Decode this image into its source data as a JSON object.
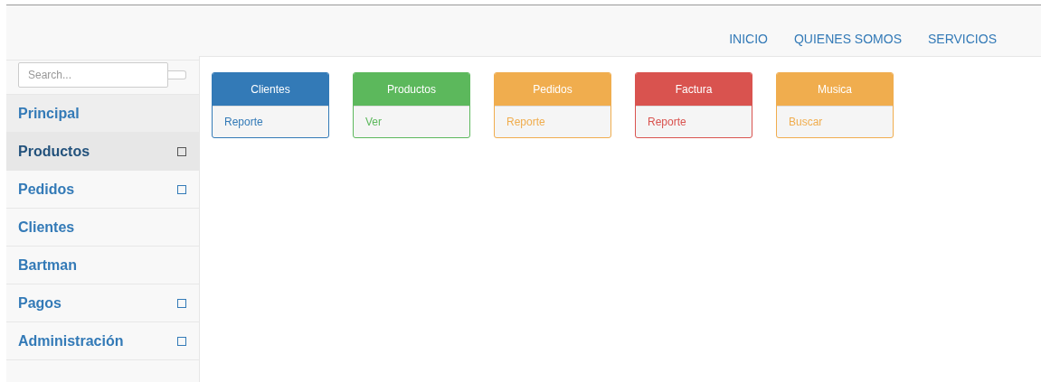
{
  "navbar": {
    "links": [
      {
        "label": "INICIO"
      },
      {
        "label": "QUIENES SOMOS"
      },
      {
        "label": "SERVICIOS"
      }
    ]
  },
  "sidebar": {
    "search": {
      "placeholder": "Search..."
    },
    "items": [
      {
        "label": "Principal",
        "kind": "heading",
        "selected": false,
        "has_submenu": false
      },
      {
        "label": "Productos",
        "kind": "item",
        "selected": true,
        "has_submenu": true
      },
      {
        "label": "Pedidos",
        "kind": "item",
        "selected": false,
        "has_submenu": true
      },
      {
        "label": "Clientes",
        "kind": "item",
        "selected": false,
        "has_submenu": false
      },
      {
        "label": "Bartman",
        "kind": "item",
        "selected": false,
        "has_submenu": false
      },
      {
        "label": "Pagos",
        "kind": "item",
        "selected": false,
        "has_submenu": true
      },
      {
        "label": "Administración",
        "kind": "item",
        "selected": false,
        "has_submenu": true
      }
    ]
  },
  "cards": [
    {
      "title": "Clientes",
      "link": "Reporte",
      "color": "#337ab7"
    },
    {
      "title": "Productos",
      "link": "Ver",
      "color": "#5cb85c"
    },
    {
      "title": "Pedidos",
      "link": "Reporte",
      "color": "#f0ad4e"
    },
    {
      "title": "Factura",
      "link": "Reporte",
      "color": "#d9534f"
    },
    {
      "title": "Musica",
      "link": "Buscar",
      "color": "#f0ad4e"
    }
  ]
}
